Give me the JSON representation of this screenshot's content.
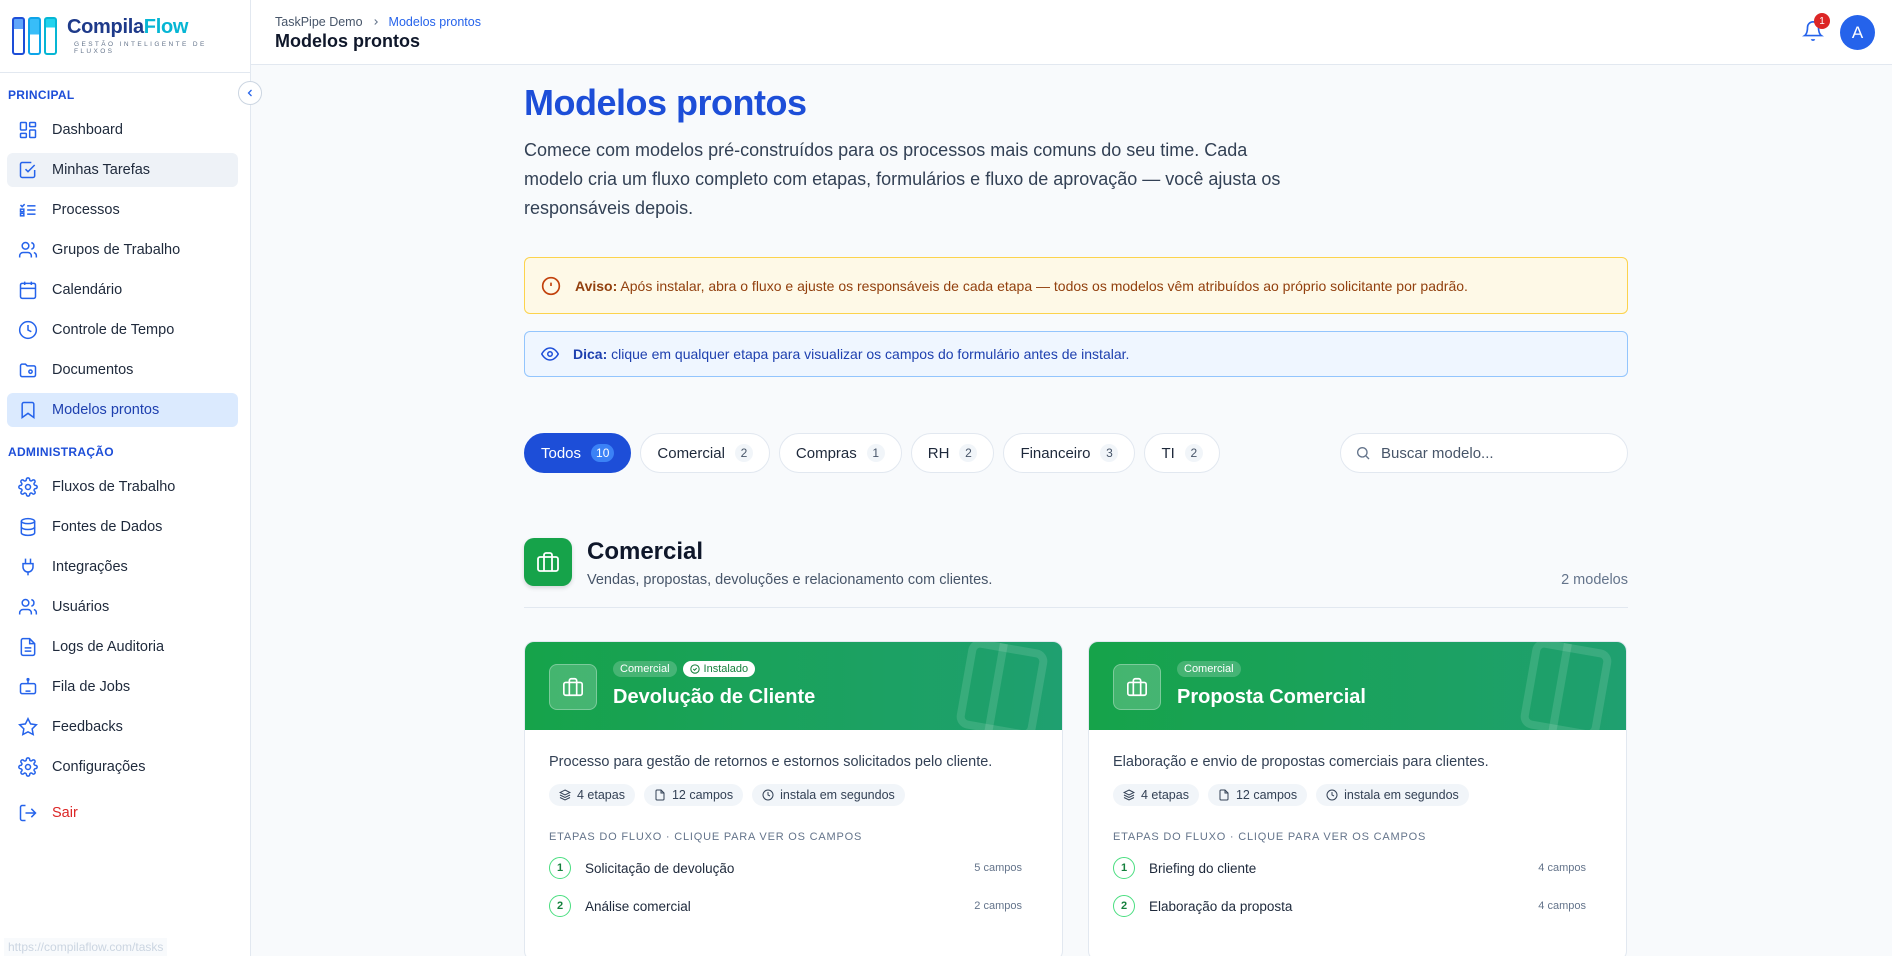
{
  "brand": {
    "name_part1": "Compila",
    "name_part2": "Flow",
    "tagline": "GESTÃO INTELIGENTE DE FLUXOS"
  },
  "sidebar": {
    "principal_label": "PRINCIPAL",
    "admin_label": "ADMINISTRAÇÃO",
    "principal": [
      {
        "label": "Dashboard",
        "icon": "dashboard-icon"
      },
      {
        "label": "Minhas Tarefas",
        "icon": "checkbox-icon"
      },
      {
        "label": "Processos",
        "icon": "list-check-icon"
      },
      {
        "label": "Grupos de Trabalho",
        "icon": "users-icon"
      },
      {
        "label": "Calendário",
        "icon": "calendar-icon"
      },
      {
        "label": "Controle de Tempo",
        "icon": "clock-icon"
      },
      {
        "label": "Documentos",
        "icon": "folder-icon"
      },
      {
        "label": "Modelos prontos",
        "icon": "bookmark-icon"
      }
    ],
    "admin": [
      {
        "label": "Fluxos de Trabalho",
        "icon": "gear-icon"
      },
      {
        "label": "Fontes de Dados",
        "icon": "database-icon"
      },
      {
        "label": "Integrações",
        "icon": "plug-icon"
      },
      {
        "label": "Usuários",
        "icon": "users-icon"
      },
      {
        "label": "Logs de Auditoria",
        "icon": "file-icon"
      },
      {
        "label": "Fila de Jobs",
        "icon": "robot-icon"
      },
      {
        "label": "Feedbacks",
        "icon": "star-icon"
      },
      {
        "label": "Configurações",
        "icon": "gear-icon"
      }
    ],
    "logout": "Sair",
    "status_url": "https://compilaflow.com/tasks"
  },
  "topbar": {
    "crumb_root": "TaskPipe Demo",
    "crumb_current": "Modelos prontos",
    "title": "Modelos prontos",
    "notifications": "1",
    "avatar": "A"
  },
  "main": {
    "title": "Modelos prontos",
    "lead": "Comece com modelos pré-construídos para os processos mais comuns do seu time. Cada modelo cria um fluxo completo com etapas, formulários e fluxo de aprovação — você ajusta os responsáveis depois.",
    "warn_label": "Aviso:",
    "warn_text": "Após instalar, abra o fluxo e ajuste os responsáveis de cada etapa — todos os modelos vêm atribuídos ao próprio solicitante por padrão.",
    "tip_label": "Dica:",
    "tip_text": "clique em qualquer etapa para visualizar os campos do formulário antes de instalar.",
    "filters": [
      {
        "label": "Todos",
        "count": "10"
      },
      {
        "label": "Comercial",
        "count": "2"
      },
      {
        "label": "Compras",
        "count": "1"
      },
      {
        "label": "RH",
        "count": "2"
      },
      {
        "label": "Financeiro",
        "count": "3"
      },
      {
        "label": "TI",
        "count": "2"
      }
    ],
    "search_placeholder": "Buscar modelo...",
    "category": {
      "title": "Comercial",
      "desc": "Vendas, propostas, devoluções e relacionamento com clientes.",
      "count": "2 modelos"
    },
    "cards": [
      {
        "tag": "Comercial",
        "installed": "Instalado",
        "title": "Devolução de Cliente",
        "desc": "Processo para gestão de retornos e estornos solicitados pelo cliente.",
        "steps_count": "4 etapas",
        "fields_count": "12 campos",
        "install_time": "instala em segundos",
        "flow_label": "ETAPAS DO FLUXO · CLIQUE PARA VER OS CAMPOS",
        "steps": [
          {
            "n": "1",
            "name": "Solicitação de devolução",
            "fields": "5 campos"
          },
          {
            "n": "2",
            "name": "Análise comercial",
            "fields": "2 campos"
          }
        ]
      },
      {
        "tag": "Comercial",
        "title": "Proposta Comercial",
        "desc": "Elaboração e envio de propostas comerciais para clientes.",
        "steps_count": "4 etapas",
        "fields_count": "12 campos",
        "install_time": "instala em segundos",
        "flow_label": "ETAPAS DO FLUXO · CLIQUE PARA VER OS CAMPOS",
        "steps": [
          {
            "n": "1",
            "name": "Briefing do cliente",
            "fields": "4 campos"
          },
          {
            "n": "2",
            "name": "Elaboração da proposta",
            "fields": "4 campos"
          }
        ]
      }
    ]
  },
  "colors": {
    "primary": "#1d4ed8",
    "green": "#16a34a",
    "danger": "#dc2626"
  }
}
